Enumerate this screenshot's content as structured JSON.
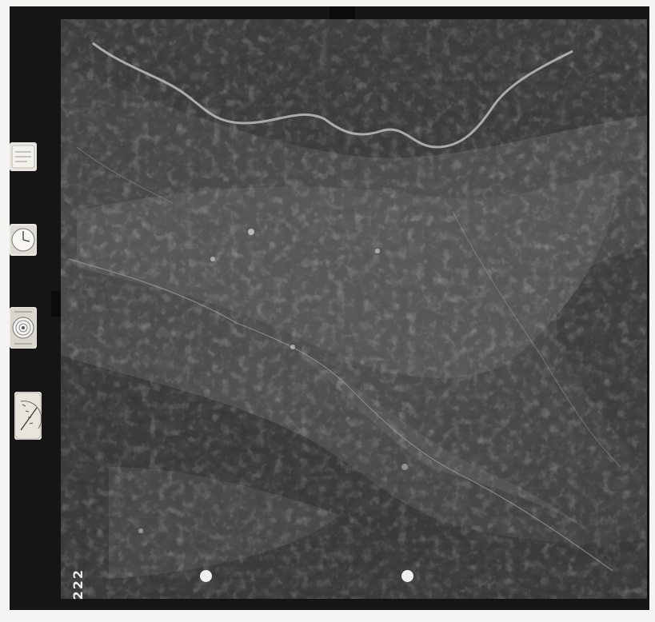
{
  "image": {
    "subject": "aerial-photograph",
    "tone": "monochrome",
    "frame_number": "222"
  },
  "instruments": [
    {
      "name": "label-card",
      "icon": "card-icon"
    },
    {
      "name": "clock",
      "icon": "clock-icon"
    },
    {
      "name": "altimeter",
      "icon": "altimeter-icon"
    },
    {
      "name": "level-gauge",
      "icon": "level-gauge-icon"
    }
  ],
  "colors": {
    "frame": "#151515",
    "sheet": "#f4f4f2",
    "terrain_light": "#8a8a8a",
    "terrain_dark": "#2a2a2a",
    "river": "#bdbdbd"
  }
}
